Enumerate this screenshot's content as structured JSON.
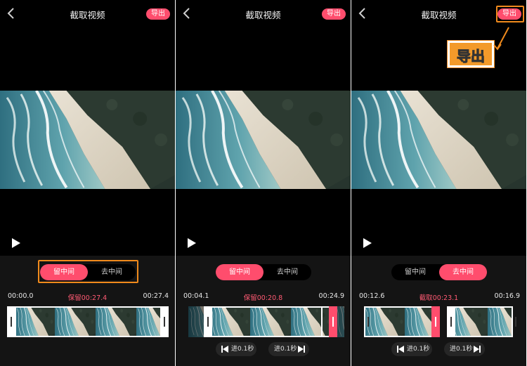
{
  "colors": {
    "accent": "#ff4d6d",
    "highlight": "#f08a1c",
    "background": "#000000",
    "panel": "#141414"
  },
  "panels": [
    {
      "title": "截取视频",
      "export_label": "导出",
      "mode_left": "留中间",
      "mode_right": "去中间",
      "selected_mode": "留中间",
      "time_start": "00:00.0",
      "time_center": "保留00:27.4",
      "time_end": "00:27.4",
      "icons": {
        "back": "back-arrow-icon",
        "play": "play-icon"
      }
    },
    {
      "title": "截取视频",
      "export_label": "导出",
      "mode_left": "留中间",
      "mode_right": "去中间",
      "selected_mode": "留中间",
      "time_start": "00:04.1",
      "time_center": "保留00:20.8",
      "time_end": "00:24.9",
      "step_back_label": "进0.1秒",
      "step_forward_label": "进0.1秒",
      "icons": {
        "step_back": "skip-previous-icon",
        "step_forward": "skip-next-icon"
      }
    },
    {
      "title": "截取视频",
      "export_label": "导出",
      "mode_left": "留中间",
      "mode_right": "去中间",
      "selected_mode": "去中间",
      "time_start": "00:12.6",
      "time_center": "截取00:23.1",
      "time_end": "00:16.9",
      "step_back_label": "进0.1秒",
      "step_forward_label": "进0.1秒"
    }
  ],
  "callout": {
    "label": "导出"
  }
}
